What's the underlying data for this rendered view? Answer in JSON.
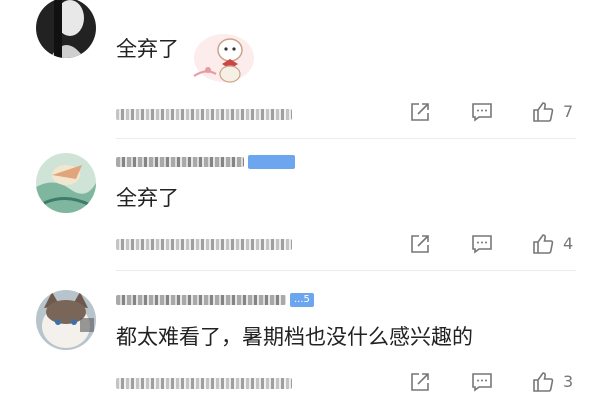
{
  "comments": [
    {
      "content": "全弃了",
      "has_sticker": true,
      "likes": "7"
    },
    {
      "content": "全弃了",
      "badge": "",
      "likes": "4"
    },
    {
      "content": "都太难看了，暑期档也没什么感兴趣的",
      "badge": "...5",
      "likes": "3"
    }
  ],
  "icons": {
    "share": "share-icon",
    "comment": "comment-icon",
    "like": "thumbs-up-icon"
  },
  "colors": {
    "text": "#222222",
    "muted": "#777777",
    "badge": "#6ca6ee",
    "divider": "#ececec"
  }
}
